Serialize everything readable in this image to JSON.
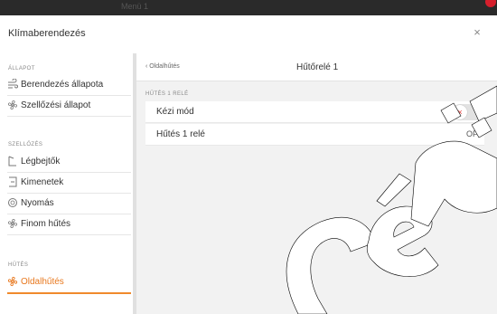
{
  "window": {
    "top_title": "Menü 1",
    "dialog_title": "Klímaberendezés",
    "close_glyph": "×"
  },
  "sidebar": {
    "sections": [
      {
        "heading": "ÁLLAPOT",
        "items": [
          {
            "label": "Berendezés állapota",
            "icon": "wind-icon"
          },
          {
            "label": "Szellőzési állapot",
            "icon": "fan-icon"
          }
        ]
      },
      {
        "heading": "SZELLŐZÉS",
        "items": [
          {
            "label": "Légbejtők",
            "icon": "intake-icon"
          },
          {
            "label": "Kimenetek",
            "icon": "outlet-icon"
          },
          {
            "label": "Nyomás",
            "icon": "gauge-icon"
          },
          {
            "label": "Finom hűtés",
            "icon": "fan-icon"
          }
        ]
      },
      {
        "heading": "HŰTÉS",
        "items": [
          {
            "label": "Oldalhűtés",
            "icon": "cooling-icon",
            "active": true
          }
        ]
      }
    ]
  },
  "main": {
    "back_label": "Oldalhűtés",
    "title": "Hűtőrelé 1",
    "group_heading": "HŰTÉS 1 RELÉ",
    "rows": [
      {
        "label": "Kézi mód",
        "control": "toggle",
        "state": "off"
      },
      {
        "label": "Hűtés 1 relé",
        "value": "OFF"
      }
    ]
  },
  "colors": {
    "accent": "#f08a2c",
    "toggle_x": "#e53935",
    "watermark": "#000000"
  }
}
